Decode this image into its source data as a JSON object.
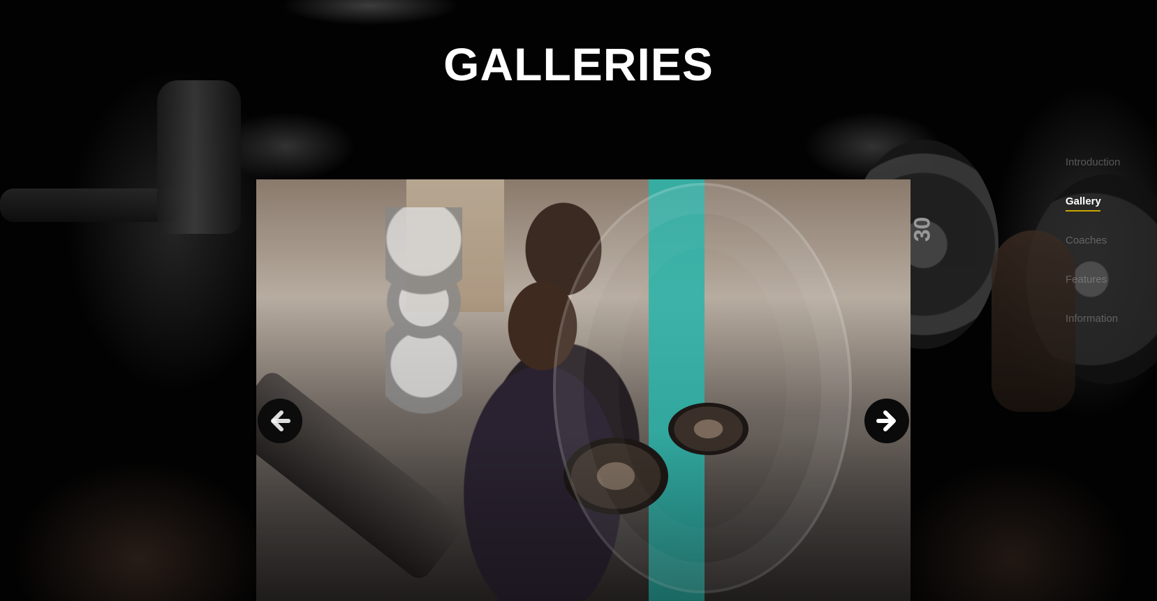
{
  "page": {
    "title": "GALLERIES"
  },
  "background": {
    "plate_number": "30"
  },
  "slider": {
    "prev_icon": "arrow-left-icon",
    "next_icon": "arrow-right-icon"
  },
  "nav": {
    "items": [
      {
        "label": "Introduction",
        "active": false
      },
      {
        "label": "Gallery",
        "active": true
      },
      {
        "label": "Coaches",
        "active": false
      },
      {
        "label": "Features",
        "active": false
      },
      {
        "label": "Information",
        "active": false
      }
    ],
    "accent_color": "#c8a400"
  }
}
